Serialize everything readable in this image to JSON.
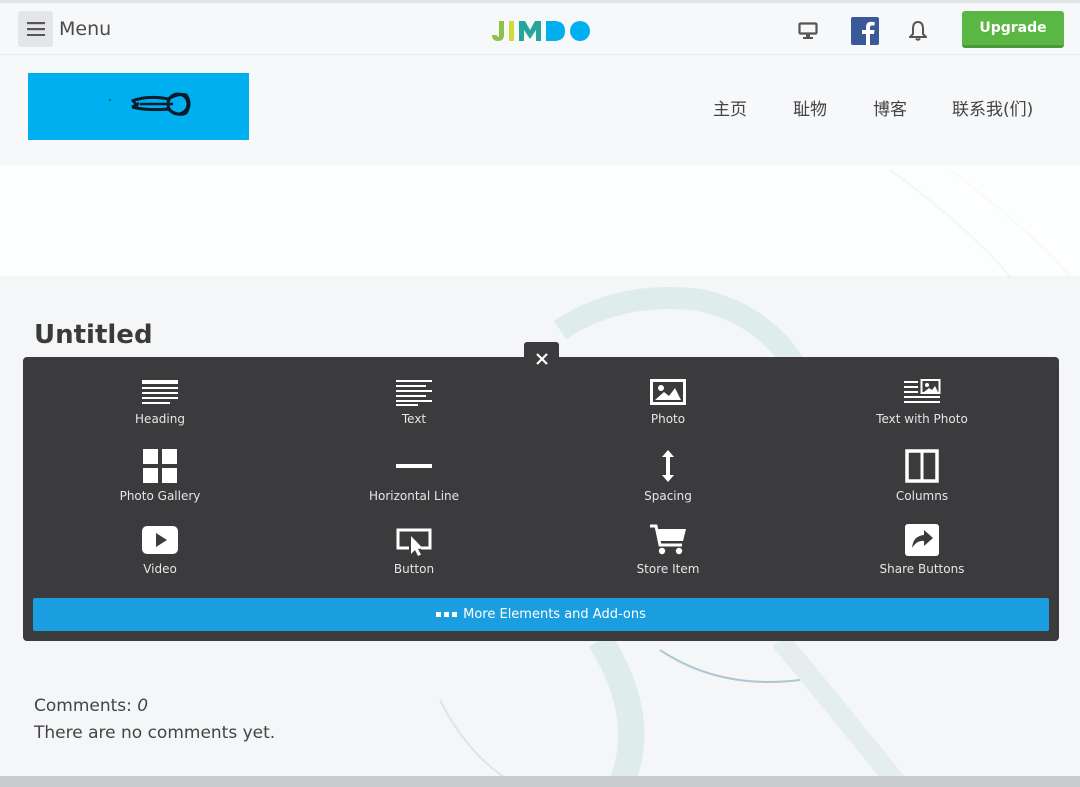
{
  "topbar": {
    "menu_label": "Menu",
    "logo_text": "JIMDO",
    "upgrade_label": "Upgrade"
  },
  "nav": {
    "items": [
      "主页",
      "耻物",
      "博客",
      "联系我(们)"
    ]
  },
  "page": {
    "title": "Untitled"
  },
  "panel": {
    "tiles": [
      {
        "label": "Heading",
        "icon": "heading-icon"
      },
      {
        "label": "Text",
        "icon": "text-icon"
      },
      {
        "label": "Photo",
        "icon": "photo-icon"
      },
      {
        "label": "Text with Photo",
        "icon": "text-with-photo-icon"
      },
      {
        "label": "Photo Gallery",
        "icon": "photo-gallery-icon"
      },
      {
        "label": "Horizontal Line",
        "icon": "horizontal-line-icon"
      },
      {
        "label": "Spacing",
        "icon": "spacing-icon"
      },
      {
        "label": "Columns",
        "icon": "columns-icon"
      },
      {
        "label": "Video",
        "icon": "video-icon"
      },
      {
        "label": "Button",
        "icon": "button-icon"
      },
      {
        "label": "Store Item",
        "icon": "cart-icon"
      },
      {
        "label": "Share Buttons",
        "icon": "share-icon"
      }
    ],
    "more_label": "More Elements and Add-ons"
  },
  "comments": {
    "label": "Comments:",
    "count": "0",
    "empty_text": "There are no comments yet."
  },
  "colors": {
    "accent_green": "#5bb744",
    "panel_bg": "#3b3b3d",
    "more_blue": "#1a9ee0",
    "logo_blue": "#00aff0"
  }
}
